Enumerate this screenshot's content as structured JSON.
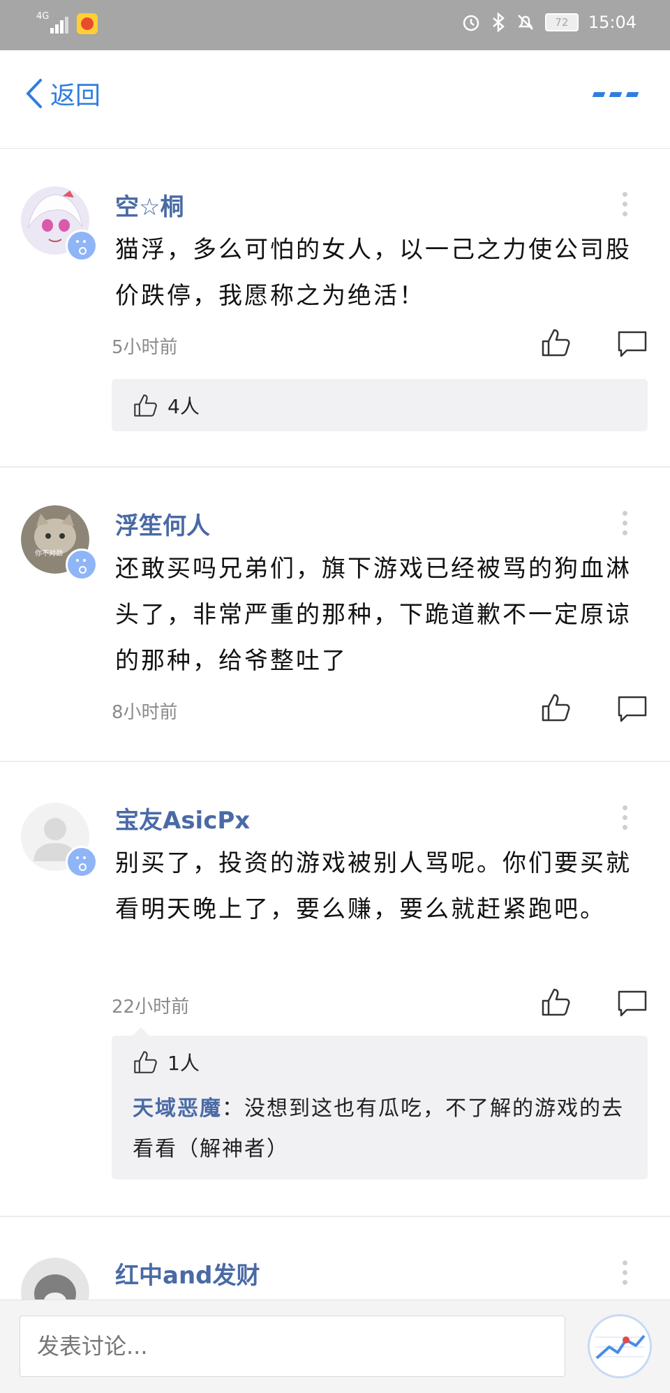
{
  "status": {
    "time": "15:04",
    "battery": "72",
    "network": "4G"
  },
  "nav": {
    "back_label": "返回"
  },
  "comments": [
    {
      "username": "空☆桐",
      "text": "猫浮，多么可怕的女人，以一己之力使公司股价跌停，我愿称之为绝活！",
      "time": "5小时前",
      "likes": "4人"
    },
    {
      "username": "浮笙何人",
      "text": "还敢买吗兄弟们，旗下游戏已经被骂的狗血淋头了，非常严重的那种，下跪道歉不一定原谅的那种，给爷整吐了",
      "time": "8小时前",
      "avatar_caption": "你不对劲"
    },
    {
      "username": "宝友AsicPx",
      "text": "别买了，投资的游戏被别人骂呢。你们要买就看明天晚上了，要么赚，要么就赶紧跑吧。",
      "time": "22小时前",
      "likes": "1人",
      "reply_author": "天域恶魔",
      "reply_text": "：没想到这也有瓜吃，不了解的游戏的去看看（解神者）"
    },
    {
      "username": "红中and发财"
    }
  ],
  "composer": {
    "placeholder": "发表讨论..."
  },
  "colors": {
    "accent": "#2f7de1",
    "username": "#4a6aa5",
    "panel_bg": "#f1f1f4"
  }
}
